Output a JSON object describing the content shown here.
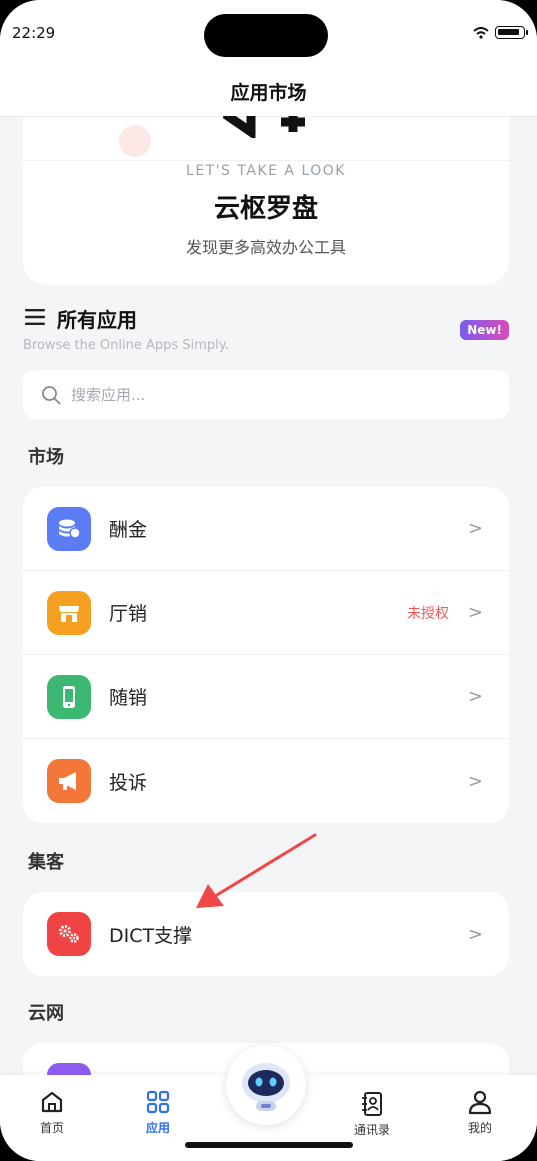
{
  "status_bar": {
    "time": "22:29"
  },
  "header": {
    "title": "应用市场"
  },
  "hero": {
    "subtitle": "LET'S TAKE A LOOK",
    "title": "云枢罗盘",
    "description": "发现更多高效办公工具"
  },
  "section": {
    "title": "所有应用",
    "subtitle": "Browse the Online Apps Simply.",
    "badge": "New!"
  },
  "search": {
    "placeholder": "搜索应用..."
  },
  "groups": [
    {
      "label": "市场",
      "items": [
        {
          "label": "酬金",
          "status": "",
          "icon": "coins-icon",
          "color": "#5b7cf5"
        },
        {
          "label": "厅销",
          "status": "未授权",
          "icon": "store-icon",
          "color": "#f5a020"
        },
        {
          "label": "随销",
          "status": "",
          "icon": "phone-icon",
          "color": "#3db873"
        },
        {
          "label": "投诉",
          "status": "",
          "icon": "megaphone-icon",
          "color": "#f4773a"
        }
      ]
    },
    {
      "label": "集客",
      "items": [
        {
          "label": "DICT支撑",
          "status": "",
          "icon": "gears-icon",
          "color": "#f04343"
        }
      ]
    },
    {
      "label": "云网",
      "items": []
    }
  ],
  "chevron": ">",
  "tabbar": {
    "items": [
      {
        "label": "首页",
        "icon": "home-icon",
        "active": false
      },
      {
        "label": "应用",
        "icon": "grid-icon",
        "active": true
      },
      {
        "label": "通讯录",
        "icon": "contacts-icon",
        "active": false
      },
      {
        "label": "我的",
        "icon": "user-icon",
        "active": false
      }
    ]
  },
  "colors": {
    "accent": "#2f6ff0",
    "warning": "#f25a5a",
    "annotation_arrow": "#f04848"
  }
}
